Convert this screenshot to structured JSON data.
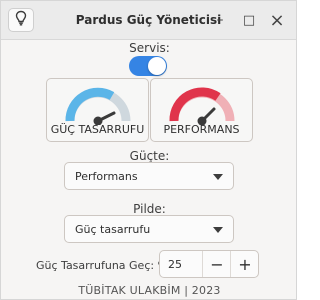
{
  "window": {
    "title": "Pardus Güç Yöneticisi"
  },
  "titlebar": {
    "menu_icon": "lightbulb-icon",
    "minimize": "–",
    "maximize": "□",
    "close": "×"
  },
  "service": {
    "label": "Servis:",
    "enabled": true,
    "accent": "#3584e4"
  },
  "modes": {
    "power_saver": {
      "label": "GÜÇ TASARRUFU",
      "gauge_color": "#5bb5e8",
      "icon": "gauge-low-icon"
    },
    "performance": {
      "label": "PERFORMANS",
      "gauge_color": "#e0344b",
      "icon": "gauge-high-icon"
    }
  },
  "plugged": {
    "label": "Güçte:",
    "value": "Performans"
  },
  "battery": {
    "label": "Pilde:",
    "value": "Güç tasarrufu"
  },
  "threshold": {
    "label": "Güç Tasarrufuna Geç: %",
    "value": "25",
    "decrement": "−",
    "increment": "+"
  },
  "footer": {
    "text": "TÜBİTAK ULAKBİM | 2023"
  }
}
